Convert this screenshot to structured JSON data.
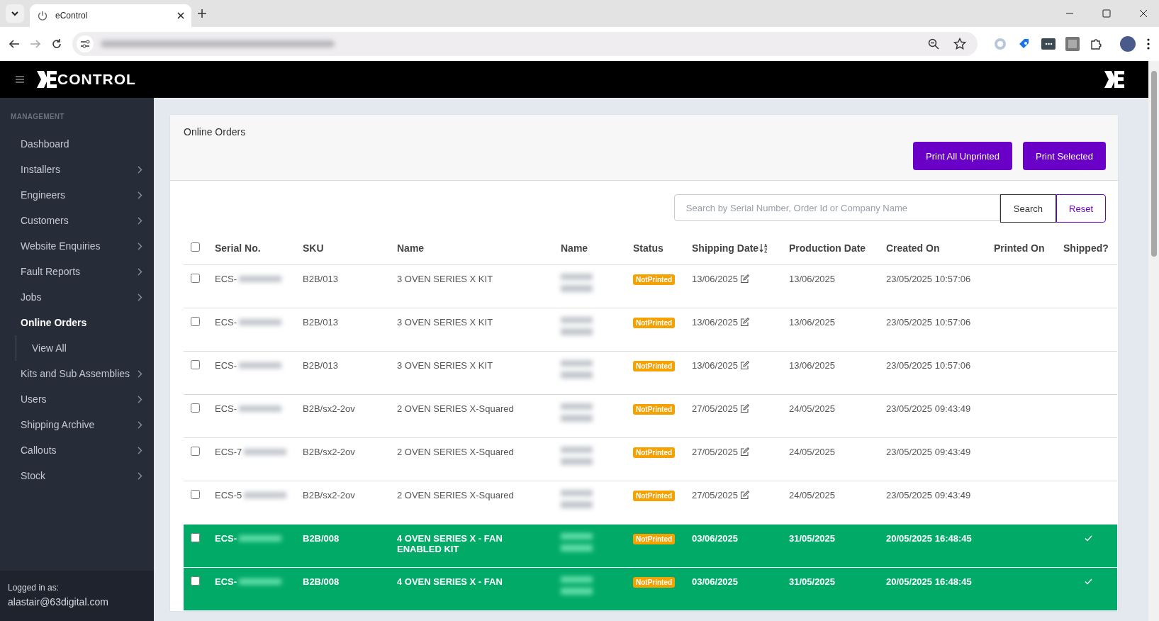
{
  "browser": {
    "tab_title": "eControl"
  },
  "app_header": {
    "logo_text": "CONTROL"
  },
  "sidebar": {
    "section": "MANAGEMENT",
    "items": [
      {
        "label": "Dashboard",
        "selected": false,
        "expandable": false
      },
      {
        "label": "Installers",
        "selected": false,
        "expandable": true
      },
      {
        "label": "Engineers",
        "selected": false,
        "expandable": true
      },
      {
        "label": "Customers",
        "selected": false,
        "expandable": true
      },
      {
        "label": "Website Enquiries",
        "selected": false,
        "expandable": true
      },
      {
        "label": "Fault Reports",
        "selected": false,
        "expandable": true
      },
      {
        "label": "Jobs",
        "selected": false,
        "expandable": true
      },
      {
        "label": "Online Orders",
        "selected": true,
        "expandable": false,
        "children": [
          {
            "label": "View All",
            "selected": false
          }
        ]
      },
      {
        "label": "Kits and Sub Assemblies",
        "selected": false,
        "expandable": true
      },
      {
        "label": "Users",
        "selected": false,
        "expandable": true
      },
      {
        "label": "Shipping Archive",
        "selected": false,
        "expandable": true
      },
      {
        "label": "Callouts",
        "selected": false,
        "expandable": true
      },
      {
        "label": "Stock",
        "selected": false,
        "expandable": true
      }
    ],
    "footer_label": "Logged in as:",
    "user": "alastair@63digital.com"
  },
  "page": {
    "title": "Online Orders",
    "buttons": [
      "Print All Unprinted",
      "Print Selected"
    ],
    "search": {
      "placeholder": "Search by Serial Number, Order Id or Company Name",
      "search_button": "Search",
      "reset_button": "Reset"
    },
    "table": {
      "select_all_checked": false,
      "columns": [
        {
          "label": "Serial No.",
          "sorted": false
        },
        {
          "label": "SKU",
          "sorted": false
        },
        {
          "label": "Name",
          "sorted": false
        },
        {
          "label": "Name",
          "sorted": false
        },
        {
          "label": "Status",
          "sorted": false
        },
        {
          "label": "Shipping Date",
          "sorted": true
        },
        {
          "label": "Production Date",
          "sorted": false
        },
        {
          "label": "Created On",
          "sorted": false
        },
        {
          "label": "Printed On",
          "sorted": false
        },
        {
          "label": "Shipped?",
          "sorted": false
        }
      ],
      "rows": [
        {
          "checked": false,
          "serial": "ECS-",
          "sku": "B2B/013",
          "product": "3 OVEN SERIES X KIT",
          "status": "NotPrinted",
          "shipping_date": "13/06/2025",
          "date_editable": true,
          "production_date": "13/06/2025",
          "created_on": "23/05/2025 10:57:06",
          "shipped": false
        },
        {
          "checked": false,
          "serial": "ECS-",
          "sku": "B2B/013",
          "product": "3 OVEN SERIES X KIT",
          "status": "NotPrinted",
          "shipping_date": "13/06/2025",
          "date_editable": true,
          "production_date": "13/06/2025",
          "created_on": "23/05/2025 10:57:06",
          "shipped": false
        },
        {
          "checked": false,
          "serial": "ECS-",
          "sku": "B2B/013",
          "product": "3 OVEN SERIES X KIT",
          "status": "NotPrinted",
          "shipping_date": "13/06/2025",
          "date_editable": true,
          "production_date": "13/06/2025",
          "created_on": "23/05/2025 10:57:06",
          "shipped": false
        },
        {
          "checked": false,
          "serial": "ECS-",
          "sku": "B2B/sx2-2ov",
          "product": "2 OVEN SERIES X-Squared",
          "status": "NotPrinted",
          "shipping_date": "27/05/2025",
          "date_editable": true,
          "production_date": "24/05/2025",
          "created_on": "23/05/2025 09:43:49",
          "shipped": false
        },
        {
          "checked": false,
          "serial": "ECS-7",
          "sku": "B2B/sx2-2ov",
          "product": "2 OVEN SERIES X-Squared",
          "status": "NotPrinted",
          "shipping_date": "27/05/2025",
          "date_editable": true,
          "production_date": "24/05/2025",
          "created_on": "23/05/2025 09:43:49",
          "shipped": false
        },
        {
          "checked": false,
          "serial": "ECS-5",
          "sku": "B2B/sx2-2ov",
          "product": "2 OVEN SERIES X-Squared",
          "status": "NotPrinted",
          "shipping_date": "27/05/2025",
          "date_editable": true,
          "production_date": "24/05/2025",
          "created_on": "23/05/2025 09:43:49",
          "shipped": false
        },
        {
          "checked": false,
          "serial": "ECS-",
          "sku": "B2B/008",
          "product": "4 OVEN SERIES X - FAN ENABLED KIT",
          "status": "NotPrinted",
          "shipping_date": "03/06/2025",
          "date_editable": false,
          "production_date": "31/05/2025",
          "created_on": "20/05/2025 16:48:45",
          "shipped": true
        },
        {
          "checked": false,
          "serial": "ECS-",
          "sku": "B2B/008",
          "product": "4 OVEN SERIES X - FAN",
          "status": "NotPrinted",
          "shipping_date": "03/06/2025",
          "date_editable": false,
          "production_date": "31/05/2025",
          "created_on": "20/05/2025 16:48:45",
          "shipped": true
        }
      ]
    }
  }
}
